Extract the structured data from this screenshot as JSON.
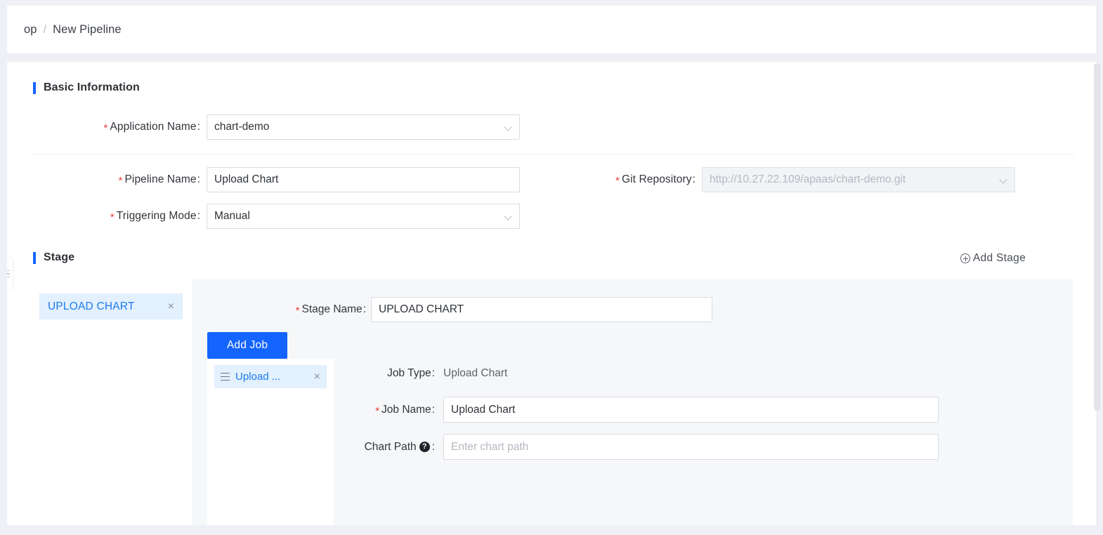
{
  "breadcrumb": {
    "root": "op",
    "separator": "/",
    "current": "New Pipeline"
  },
  "basic_information": {
    "title": "Basic Information",
    "fields": {
      "application_name": {
        "label": "Application Name",
        "value": "chart-demo",
        "required_mark": "*",
        "colon": ":"
      },
      "pipeline_name": {
        "label": "Pipeline Name",
        "value": "Upload Chart",
        "required_mark": "*",
        "colon": ":"
      },
      "triggering_mode": {
        "label": "Triggering Mode",
        "value": "Manual",
        "required_mark": "*",
        "colon": ":"
      },
      "git_repository": {
        "label": "Git Repository",
        "value": "http://10.27.22.109/apaas/chart-demo.git",
        "required_mark": "*",
        "colon": ":",
        "disabled": true
      }
    }
  },
  "stage_section": {
    "title": "Stage",
    "add_stage_label": "Add Stage",
    "add_stage_icon": "circle-plus-icon",
    "tabs": [
      {
        "label": "UPLOAD CHART",
        "close_icon": "×",
        "active": true
      }
    ],
    "stage_name": {
      "label": "Stage Name",
      "value": "UPLOAD CHART",
      "required_mark": "*",
      "colon": ":"
    },
    "add_job_label": "Add Job",
    "jobs": [
      {
        "label": "Upload ...",
        "drag_icon": "drag-handle-icon",
        "close_icon": "×",
        "active": true
      }
    ],
    "job_detail": {
      "job_type": {
        "label": "Job Type",
        "value": "Upload Chart",
        "colon": ":"
      },
      "job_name": {
        "label": "Job Name",
        "value": "Upload Chart",
        "required_mark": "*",
        "colon": ":"
      },
      "chart_path": {
        "label": "Chart Path",
        "placeholder": "Enter chart path",
        "value": "",
        "colon": ":",
        "help_icon": "question-mark-icon",
        "help_glyph": "?"
      }
    }
  },
  "colors": {
    "accent_blue": "#1464ff",
    "link_blue": "#1b7ced",
    "tab_bg": "#e3f0fe",
    "required_red": "#e8403a",
    "panel_gray": "#f6f7f9",
    "page_bg": "#eef0f5"
  }
}
